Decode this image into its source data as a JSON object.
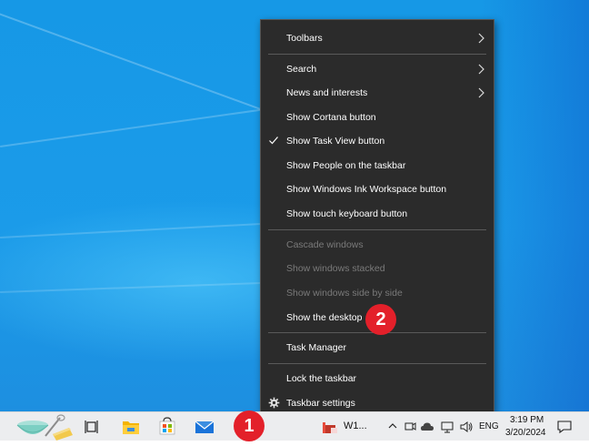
{
  "context_menu": {
    "items": [
      {
        "label": "Toolbars",
        "submenu": true
      },
      {
        "label": "Search",
        "submenu": true
      },
      {
        "label": "News and interests",
        "submenu": true
      },
      {
        "label": "Show Cortana button"
      },
      {
        "label": "Show Task View button",
        "checked": true
      },
      {
        "label": "Show People on the taskbar"
      },
      {
        "label": "Show Windows Ink Workspace button"
      },
      {
        "label": "Show touch keyboard button"
      },
      {
        "label": "Cascade windows",
        "disabled": true
      },
      {
        "label": "Show windows stacked",
        "disabled": true
      },
      {
        "label": "Show windows side by side",
        "disabled": true
      },
      {
        "label": "Show the desktop"
      },
      {
        "label": "Task Manager"
      },
      {
        "label": "Lock the taskbar"
      },
      {
        "label": "Taskbar settings",
        "icon": "gear-icon"
      }
    ]
  },
  "annotations": {
    "step1": "1",
    "step2": "2",
    "color": "#e3202a"
  },
  "taskbar": {
    "pinned": [
      "search-decoration-icon",
      "task-view-icon",
      "file-explorer-icon",
      "microsoft-store-icon",
      "mail-icon"
    ],
    "running_app_label": "W1...",
    "language": "ENG",
    "time": "3:19 PM",
    "date": "3/20/2024",
    "tray_icons": [
      "chevron-up-icon",
      "meet-now-icon",
      "weather-icon",
      "network-icon",
      "volume-icon",
      "notifications-icon"
    ]
  }
}
